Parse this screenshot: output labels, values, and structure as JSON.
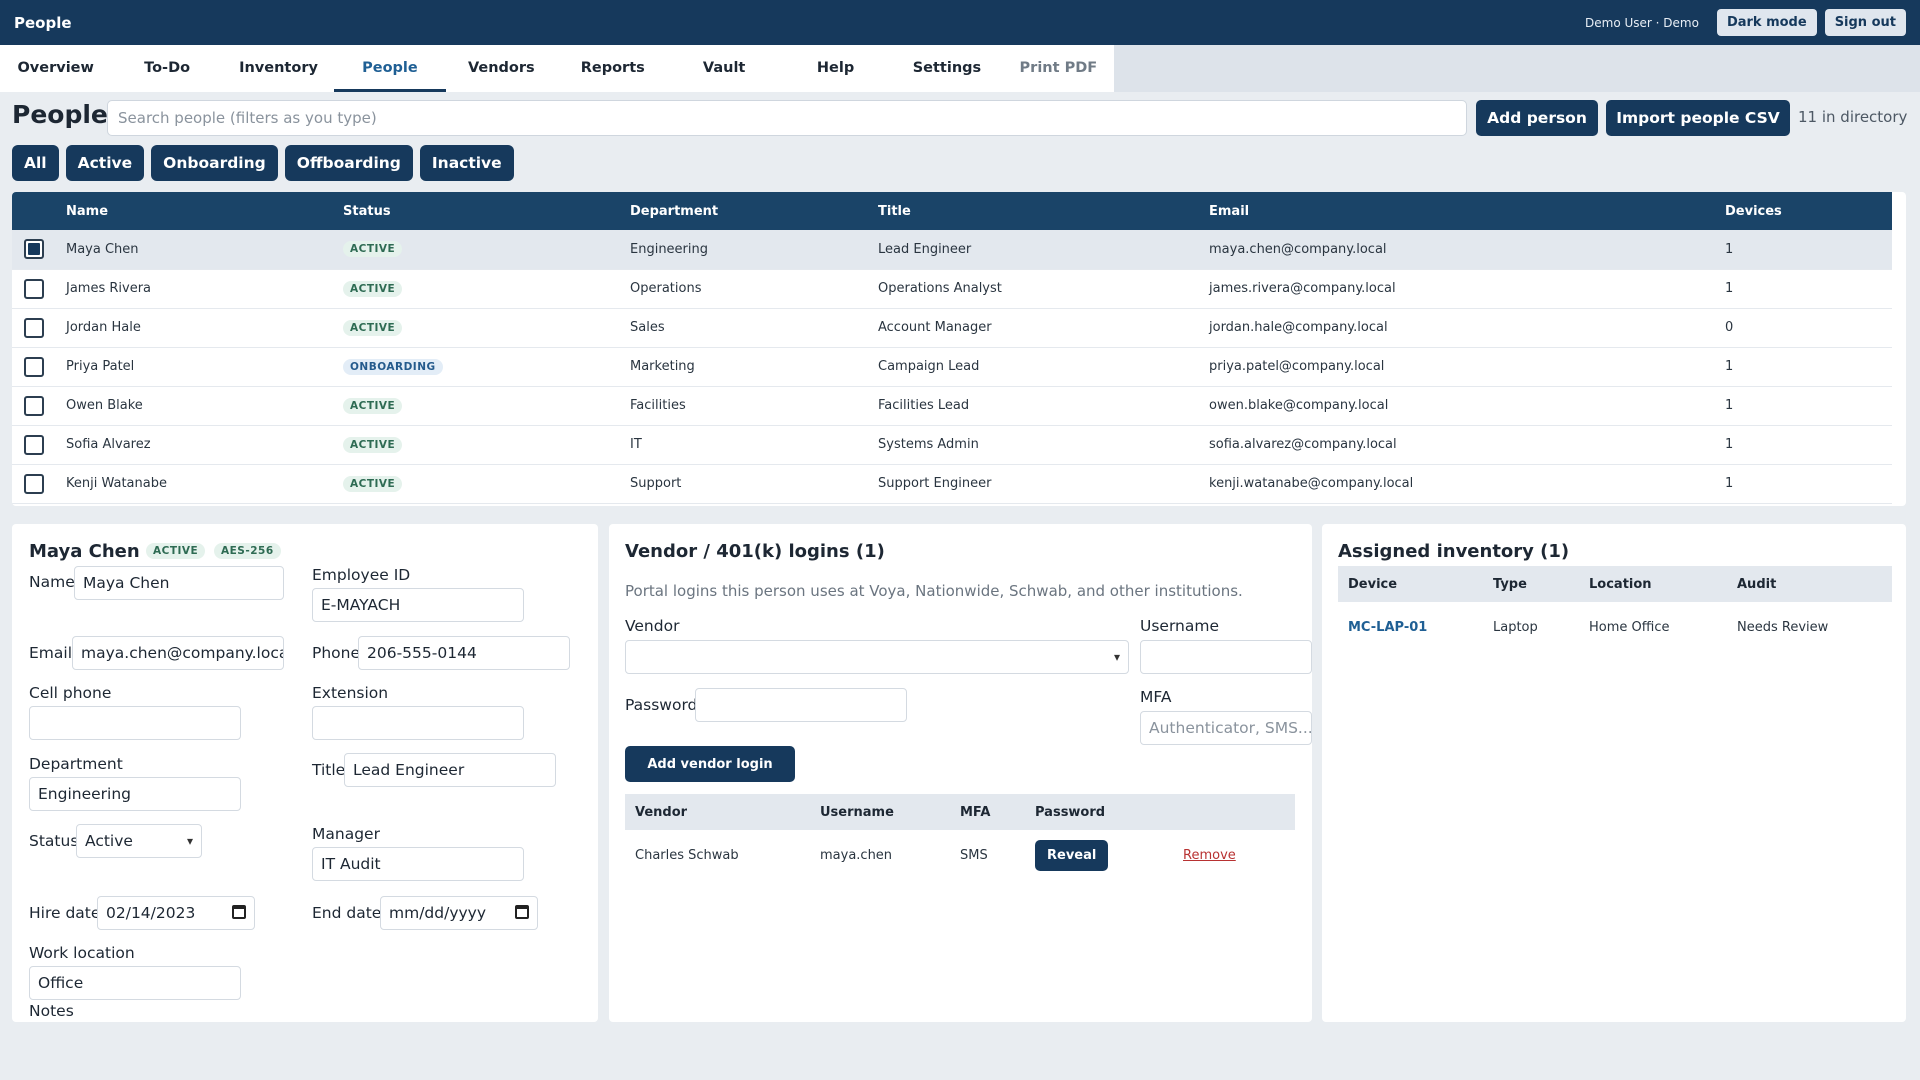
{
  "topbar": {
    "title": "People",
    "user": "Demo User · Demo",
    "dark_mode": "Dark mode",
    "sign_out": "Sign out"
  },
  "tabs": [
    {
      "label": "Overview"
    },
    {
      "label": "To-Do"
    },
    {
      "label": "Inventory"
    },
    {
      "label": "People",
      "active": true
    },
    {
      "label": "Vendors"
    },
    {
      "label": "Reports"
    },
    {
      "label": "Vault"
    },
    {
      "label": "Help"
    },
    {
      "label": "Settings"
    },
    {
      "label": "Print PDF"
    }
  ],
  "header": {
    "title": "People",
    "search_placeholder": "Search people (filters as you type)",
    "add_person": "Add person",
    "import_csv": "Import people CSV",
    "count": "11 in directory"
  },
  "filters": [
    "All",
    "Active",
    "Onboarding",
    "Offboarding",
    "Inactive"
  ],
  "table": {
    "columns": [
      "Name",
      "Status",
      "Department",
      "Title",
      "Email",
      "Devices"
    ],
    "rows": [
      {
        "name": "Maya Chen",
        "status": "ACTIVE",
        "department": "Engineering",
        "title": "Lead Engineer",
        "email": "maya.chen@company.local",
        "devices": "1",
        "selected": true
      },
      {
        "name": "James Rivera",
        "status": "ACTIVE",
        "department": "Operations",
        "title": "Operations Analyst",
        "email": "james.rivera@company.local",
        "devices": "1"
      },
      {
        "name": "Jordan Hale",
        "status": "ACTIVE",
        "department": "Sales",
        "title": "Account Manager",
        "email": "jordan.hale@company.local",
        "devices": "0"
      },
      {
        "name": "Priya Patel",
        "status": "ONBOARDING",
        "department": "Marketing",
        "title": "Campaign Lead",
        "email": "priya.patel@company.local",
        "devices": "1"
      },
      {
        "name": "Owen Blake",
        "status": "ACTIVE",
        "department": "Facilities",
        "title": "Facilities Lead",
        "email": "owen.blake@company.local",
        "devices": "1"
      },
      {
        "name": "Sofia Alvarez",
        "status": "ACTIVE",
        "department": "IT",
        "title": "Systems Admin",
        "email": "sofia.alvarez@company.local",
        "devices": "1"
      },
      {
        "name": "Kenji Watanabe",
        "status": "ACTIVE",
        "department": "Support",
        "title": "Support Engineer",
        "email": "kenji.watanabe@company.local",
        "devices": "1"
      }
    ]
  },
  "detail": {
    "name": "Maya Chen",
    "status_badge": "ACTIVE",
    "enc_badge": "AES-256",
    "labels": {
      "name": "Name",
      "employee_id": "Employee ID",
      "email": "Email",
      "phone": "Phone",
      "cell": "Cell phone",
      "extension": "Extension",
      "department": "Department",
      "title": "Title",
      "status": "Status",
      "manager": "Manager",
      "hire_date": "Hire date",
      "end_date": "End date",
      "work_location": "Work location",
      "notes": "Notes"
    },
    "values": {
      "name": "Maya Chen",
      "employee_id": "E-MAYACH",
      "email": "maya.chen@company.local",
      "phone": "206-555-0144",
      "cell": "",
      "extension": "",
      "department": "Engineering",
      "title": "Lead Engineer",
      "status": "Active",
      "manager": "IT Audit",
      "hire_date": "02/14/2023",
      "end_date": "mm/dd/yyyy",
      "work_location": "Office"
    }
  },
  "vendor": {
    "title": "Vendor / 401(k) logins (1)",
    "description": "Portal logins this person uses at Voya, Nationwide, Schwab, and other institutions.",
    "vendor_label": "Vendor",
    "username_label": "Username",
    "password_label": "Password",
    "mfa_label": "MFA",
    "mfa_placeholder": "Authenticator, SMS...",
    "add_button": "Add vendor login",
    "columns": [
      "Vendor",
      "Username",
      "MFA",
      "Password"
    ],
    "rows": [
      {
        "vendor": "Charles Schwab",
        "username": "maya.chen",
        "mfa": "SMS",
        "reveal": "Reveal",
        "remove": "Remove"
      }
    ]
  },
  "inventory": {
    "title": "Assigned inventory (1)",
    "columns": [
      "Device",
      "Type",
      "Location",
      "Audit"
    ],
    "rows": [
      {
        "device": "MC-LAP-01",
        "type": "Laptop",
        "location": "Home Office",
        "audit": "Needs Review"
      }
    ]
  }
}
